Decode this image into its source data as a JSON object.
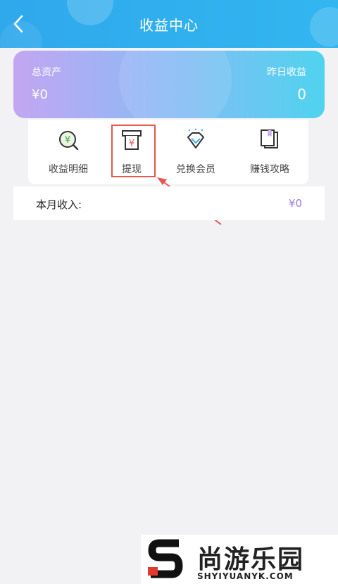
{
  "header": {
    "title": "收益中心"
  },
  "assets": {
    "total_label": "总资产",
    "total_value": "¥0",
    "yesterday_label": "昨日收益",
    "yesterday_value": "0"
  },
  "menu": {
    "items": [
      {
        "label": "收益明细",
        "icon": "money-search-icon"
      },
      {
        "label": "提现",
        "icon": "atm-withdraw-icon"
      },
      {
        "label": "兑换会员",
        "icon": "diamond-icon"
      },
      {
        "label": "赚钱攻略",
        "icon": "book-icon"
      }
    ]
  },
  "income": {
    "label": "本月收入:",
    "value": "¥0"
  },
  "watermark": {
    "cn": "尚游乐园",
    "en": "SHYIYUANYK.COM"
  },
  "colors": {
    "header": "#2fa8ec",
    "highlight": "#e8564e",
    "income_value": "#a07ae0"
  }
}
